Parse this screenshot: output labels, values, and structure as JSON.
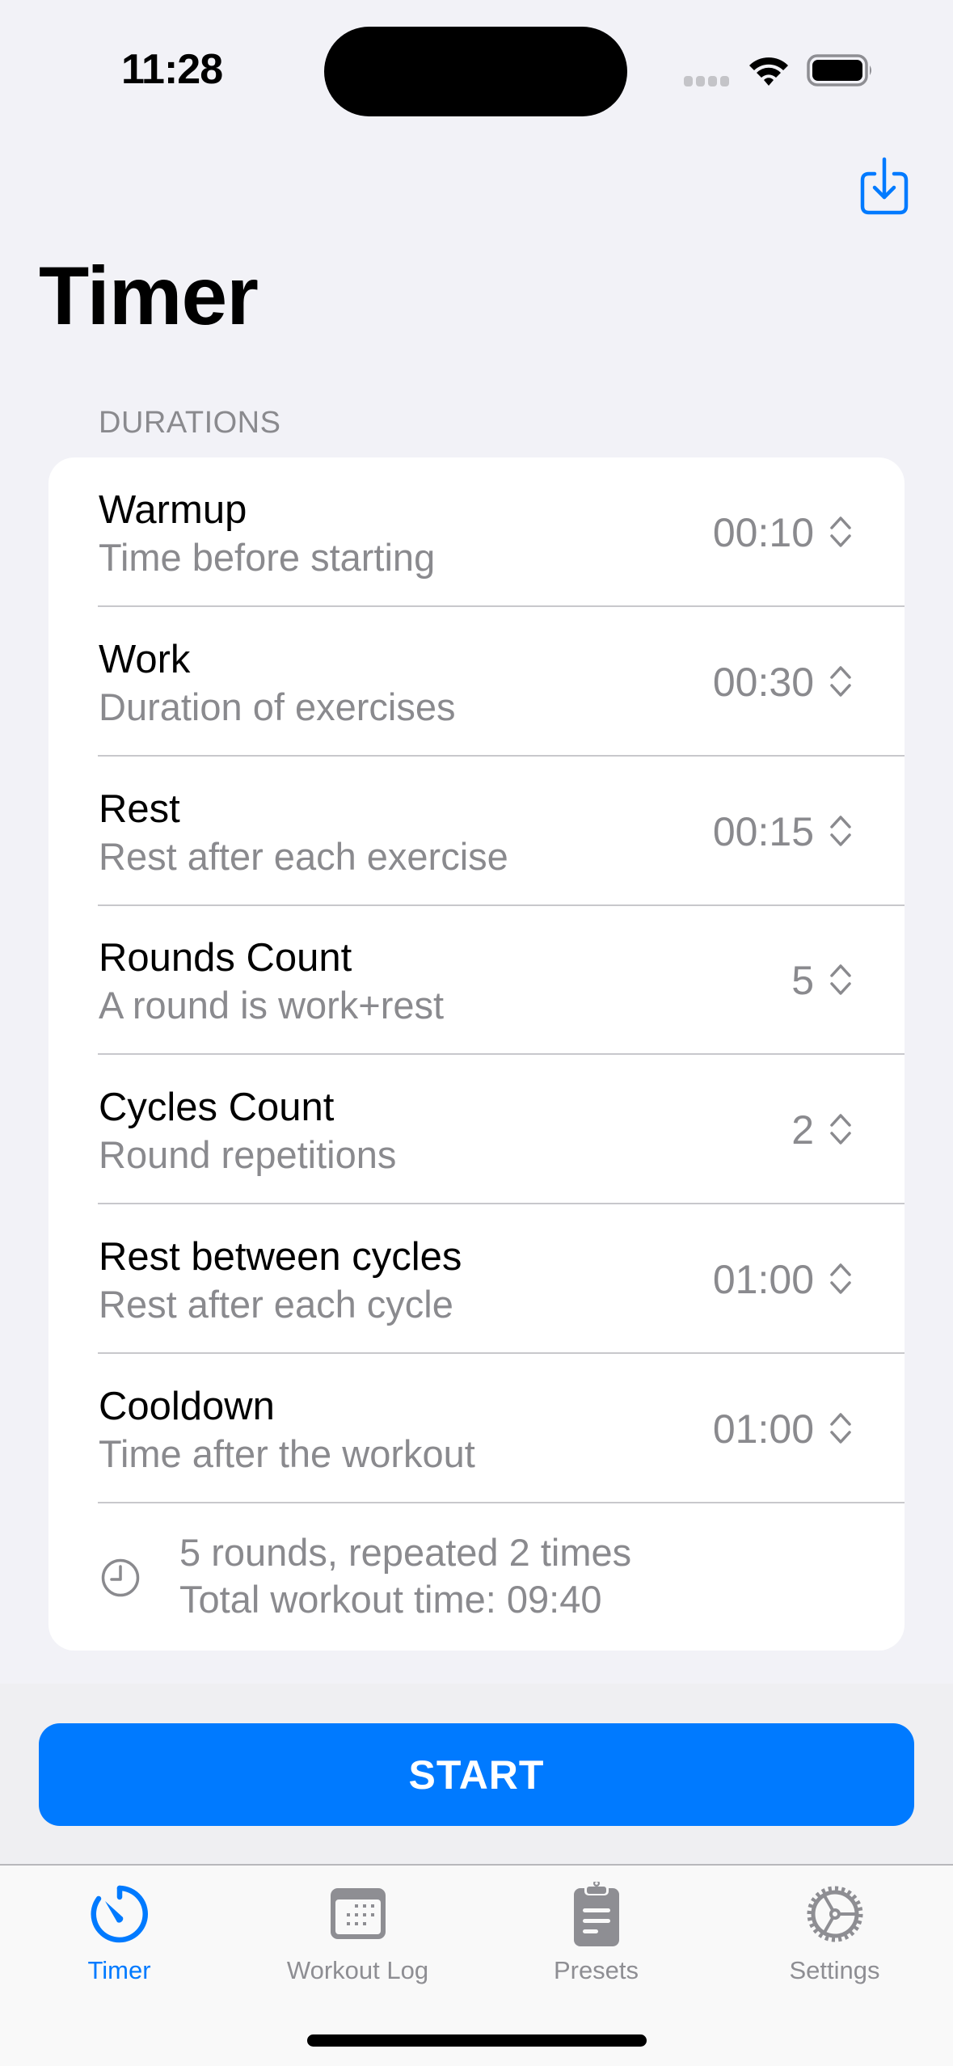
{
  "status_bar": {
    "time": "11:28",
    "icons": [
      "signal-dots-icon",
      "wifi-icon",
      "battery-icon"
    ]
  },
  "nav": {
    "action_icon": "download-tray-icon",
    "title": "Timer"
  },
  "durations": {
    "header": "DURATIONS",
    "rows": [
      {
        "title": "Warmup",
        "subtitle": "Time before starting",
        "value": "00:10"
      },
      {
        "title": "Work",
        "subtitle": "Duration of exercises",
        "value": "00:30"
      },
      {
        "title": "Rest",
        "subtitle": "Rest after each exercise",
        "value": "00:15"
      },
      {
        "title": "Rounds Count",
        "subtitle": "A round is work+rest",
        "value": "5"
      },
      {
        "title": "Cycles Count",
        "subtitle": "Round repetitions",
        "value": "2"
      },
      {
        "title": "Rest between cycles",
        "subtitle": "Rest after each cycle",
        "value": "01:00"
      },
      {
        "title": "Cooldown",
        "subtitle": "Time after the workout",
        "value": "01:00"
      }
    ],
    "summary": {
      "icon": "clock-icon",
      "line1": "5 rounds, repeated 2 times",
      "line2": "Total workout time: 09:40"
    }
  },
  "start_button": {
    "label": "START"
  },
  "tab_bar": {
    "active": "Timer",
    "tabs": [
      {
        "label": "Timer",
        "icon": "timer-icon"
      },
      {
        "label": "Workout Log",
        "icon": "calendar-icon"
      },
      {
        "label": "Presets",
        "icon": "clipboard-icon"
      },
      {
        "label": "Settings",
        "icon": "gear-icon"
      }
    ]
  },
  "colors": {
    "accent": "#007aff",
    "background": "#f2f2f7",
    "secondary_text": "#8a8a8e",
    "inactive_tab": "#8e8e93"
  }
}
